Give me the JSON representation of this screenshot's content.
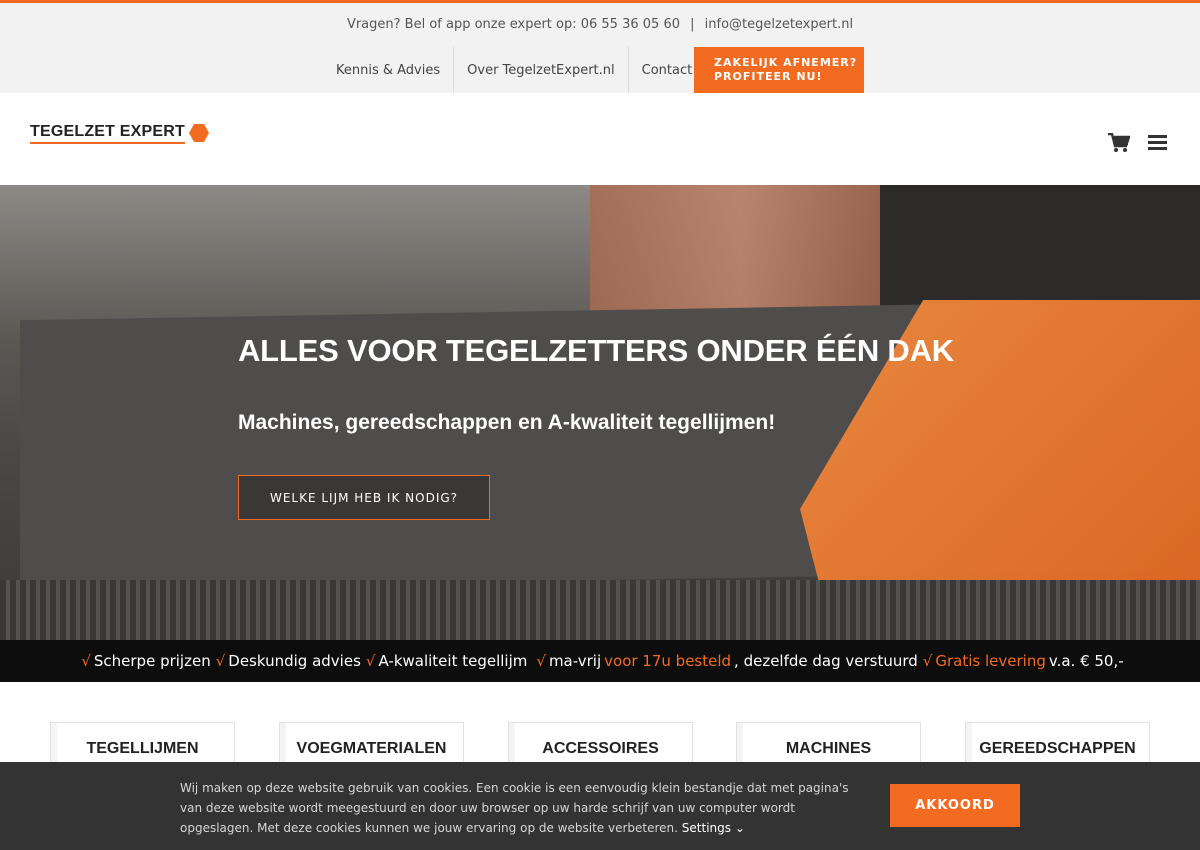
{
  "topbar": {
    "contact_text": "Vragen? Bel of app onze expert op: 06 55 36 05 60",
    "separator": "|",
    "email": "info@tegelzetexpert.nl",
    "nav": [
      "Kennis & Advies",
      "Over TegelzetExpert.nl",
      "Contact"
    ],
    "cta_line1": "ZAKELIJK AFNEMER?",
    "cta_line2": "PROFITEER NU!"
  },
  "header": {
    "logo_text": "TEGELZET EXPERT",
    "cart_icon": "shopping-cart-icon",
    "menu_icon": "hamburger-menu-icon"
  },
  "hero": {
    "title": "ALLES VOOR TEGELZETTERS ONDER ÉÉN DAK",
    "subtitle": "Machines, gereedschappen en A-kwaliteit tegellijmen!",
    "button": "WELKE LIJM HEB IK NODIG?"
  },
  "usp": {
    "check": "√",
    "item1": "Scherpe prijzen",
    "item2": "Deskundig advies",
    "item3": "A-kwaliteit tegellijm",
    "item4_prefix": "ma-vrij",
    "item4_highlight": "voor 17u besteld",
    "item4_suffix": ", dezelfde dag verstuurd",
    "item5_highlight": "Gratis levering",
    "item5_suffix": "v.a. € 50,-"
  },
  "categories": [
    "TEGELLIJMEN",
    "VOEGMATERIALEN",
    "ACCESSOIRES",
    "MACHINES",
    "GEREEDSCHAPPEN"
  ],
  "cookie": {
    "text": "Wij maken op deze website gebruik van cookies. Een cookie is een eenvoudig klein bestandje dat met pagina's van deze website wordt meegestuurd en door uw browser op uw harde schrijf van uw computer wordt opgeslagen. Met deze cookies kunnen we jouw ervaring op de website verbeteren.",
    "settings": "Settings",
    "accept": "AKKOORD"
  },
  "colors": {
    "accent": "#f26b21",
    "usp_bar": "#0d0d0d",
    "cookie_bg": "#333333"
  }
}
